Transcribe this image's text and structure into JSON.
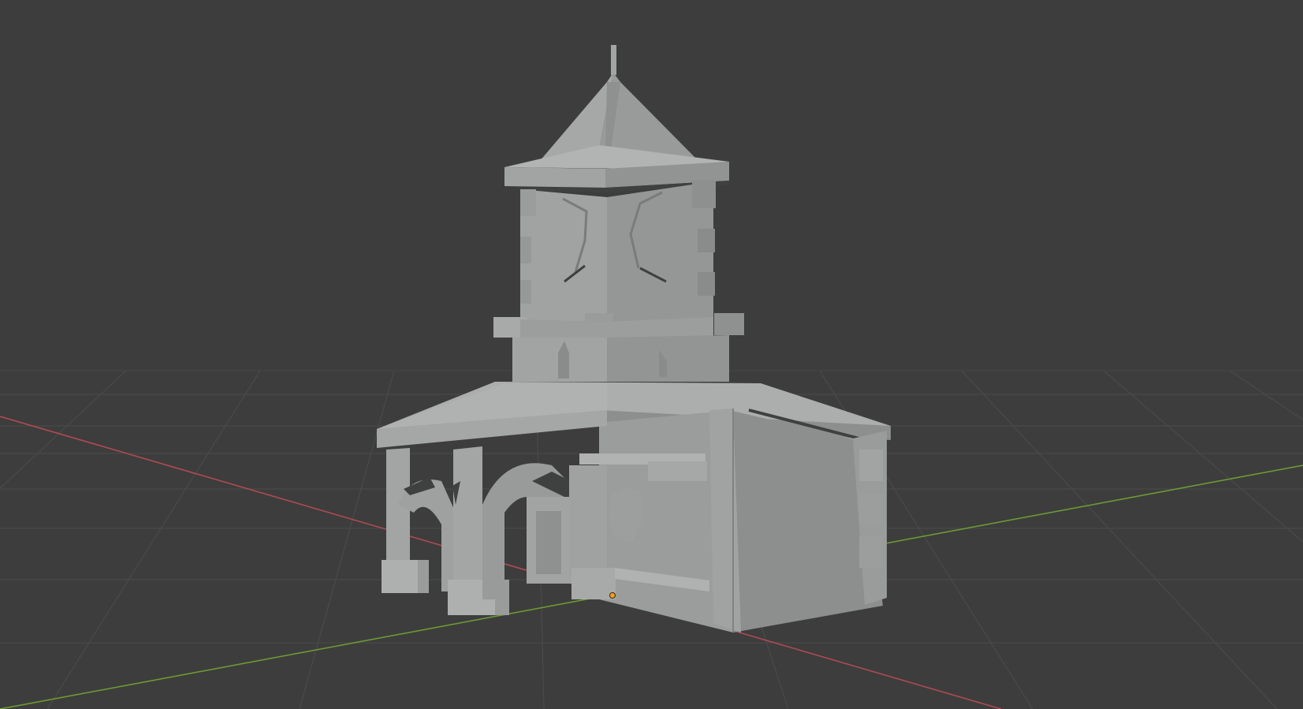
{
  "viewport": {
    "background": "#3d3d3d",
    "grid_color": "#4a4a4a",
    "x_axis_color": "#b04a52",
    "y_axis_color": "#6c9a32",
    "origin_color": "#f0a020"
  },
  "model": {
    "object": "tower-building-mesh",
    "shading": "solid",
    "colors": {
      "light": "#a3a5a5",
      "mid": "#8f9191",
      "dark": "#7c7e7e",
      "shadow": "#5a5c5c",
      "deep": "#3f4040"
    }
  }
}
